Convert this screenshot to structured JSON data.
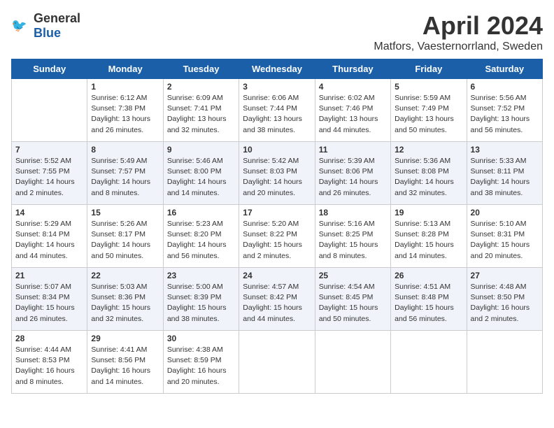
{
  "header": {
    "logo_general": "General",
    "logo_blue": "Blue",
    "month": "April 2024",
    "location": "Matfors, Vaesternorrland, Sweden"
  },
  "days_of_week": [
    "Sunday",
    "Monday",
    "Tuesday",
    "Wednesday",
    "Thursday",
    "Friday",
    "Saturday"
  ],
  "weeks": [
    [
      {
        "day": "",
        "info": ""
      },
      {
        "day": "1",
        "info": "Sunrise: 6:12 AM\nSunset: 7:38 PM\nDaylight: 13 hours\nand 26 minutes."
      },
      {
        "day": "2",
        "info": "Sunrise: 6:09 AM\nSunset: 7:41 PM\nDaylight: 13 hours\nand 32 minutes."
      },
      {
        "day": "3",
        "info": "Sunrise: 6:06 AM\nSunset: 7:44 PM\nDaylight: 13 hours\nand 38 minutes."
      },
      {
        "day": "4",
        "info": "Sunrise: 6:02 AM\nSunset: 7:46 PM\nDaylight: 13 hours\nand 44 minutes."
      },
      {
        "day": "5",
        "info": "Sunrise: 5:59 AM\nSunset: 7:49 PM\nDaylight: 13 hours\nand 50 minutes."
      },
      {
        "day": "6",
        "info": "Sunrise: 5:56 AM\nSunset: 7:52 PM\nDaylight: 13 hours\nand 56 minutes."
      }
    ],
    [
      {
        "day": "7",
        "info": "Sunrise: 5:52 AM\nSunset: 7:55 PM\nDaylight: 14 hours\nand 2 minutes."
      },
      {
        "day": "8",
        "info": "Sunrise: 5:49 AM\nSunset: 7:57 PM\nDaylight: 14 hours\nand 8 minutes."
      },
      {
        "day": "9",
        "info": "Sunrise: 5:46 AM\nSunset: 8:00 PM\nDaylight: 14 hours\nand 14 minutes."
      },
      {
        "day": "10",
        "info": "Sunrise: 5:42 AM\nSunset: 8:03 PM\nDaylight: 14 hours\nand 20 minutes."
      },
      {
        "day": "11",
        "info": "Sunrise: 5:39 AM\nSunset: 8:06 PM\nDaylight: 14 hours\nand 26 minutes."
      },
      {
        "day": "12",
        "info": "Sunrise: 5:36 AM\nSunset: 8:08 PM\nDaylight: 14 hours\nand 32 minutes."
      },
      {
        "day": "13",
        "info": "Sunrise: 5:33 AM\nSunset: 8:11 PM\nDaylight: 14 hours\nand 38 minutes."
      }
    ],
    [
      {
        "day": "14",
        "info": "Sunrise: 5:29 AM\nSunset: 8:14 PM\nDaylight: 14 hours\nand 44 minutes."
      },
      {
        "day": "15",
        "info": "Sunrise: 5:26 AM\nSunset: 8:17 PM\nDaylight: 14 hours\nand 50 minutes."
      },
      {
        "day": "16",
        "info": "Sunrise: 5:23 AM\nSunset: 8:20 PM\nDaylight: 14 hours\nand 56 minutes."
      },
      {
        "day": "17",
        "info": "Sunrise: 5:20 AM\nSunset: 8:22 PM\nDaylight: 15 hours\nand 2 minutes."
      },
      {
        "day": "18",
        "info": "Sunrise: 5:16 AM\nSunset: 8:25 PM\nDaylight: 15 hours\nand 8 minutes."
      },
      {
        "day": "19",
        "info": "Sunrise: 5:13 AM\nSunset: 8:28 PM\nDaylight: 15 hours\nand 14 minutes."
      },
      {
        "day": "20",
        "info": "Sunrise: 5:10 AM\nSunset: 8:31 PM\nDaylight: 15 hours\nand 20 minutes."
      }
    ],
    [
      {
        "day": "21",
        "info": "Sunrise: 5:07 AM\nSunset: 8:34 PM\nDaylight: 15 hours\nand 26 minutes."
      },
      {
        "day": "22",
        "info": "Sunrise: 5:03 AM\nSunset: 8:36 PM\nDaylight: 15 hours\nand 32 minutes."
      },
      {
        "day": "23",
        "info": "Sunrise: 5:00 AM\nSunset: 8:39 PM\nDaylight: 15 hours\nand 38 minutes."
      },
      {
        "day": "24",
        "info": "Sunrise: 4:57 AM\nSunset: 8:42 PM\nDaylight: 15 hours\nand 44 minutes."
      },
      {
        "day": "25",
        "info": "Sunrise: 4:54 AM\nSunset: 8:45 PM\nDaylight: 15 hours\nand 50 minutes."
      },
      {
        "day": "26",
        "info": "Sunrise: 4:51 AM\nSunset: 8:48 PM\nDaylight: 15 hours\nand 56 minutes."
      },
      {
        "day": "27",
        "info": "Sunrise: 4:48 AM\nSunset: 8:50 PM\nDaylight: 16 hours\nand 2 minutes."
      }
    ],
    [
      {
        "day": "28",
        "info": "Sunrise: 4:44 AM\nSunset: 8:53 PM\nDaylight: 16 hours\nand 8 minutes."
      },
      {
        "day": "29",
        "info": "Sunrise: 4:41 AM\nSunset: 8:56 PM\nDaylight: 16 hours\nand 14 minutes."
      },
      {
        "day": "30",
        "info": "Sunrise: 4:38 AM\nSunset: 8:59 PM\nDaylight: 16 hours\nand 20 minutes."
      },
      {
        "day": "",
        "info": ""
      },
      {
        "day": "",
        "info": ""
      },
      {
        "day": "",
        "info": ""
      },
      {
        "day": "",
        "info": ""
      }
    ]
  ]
}
